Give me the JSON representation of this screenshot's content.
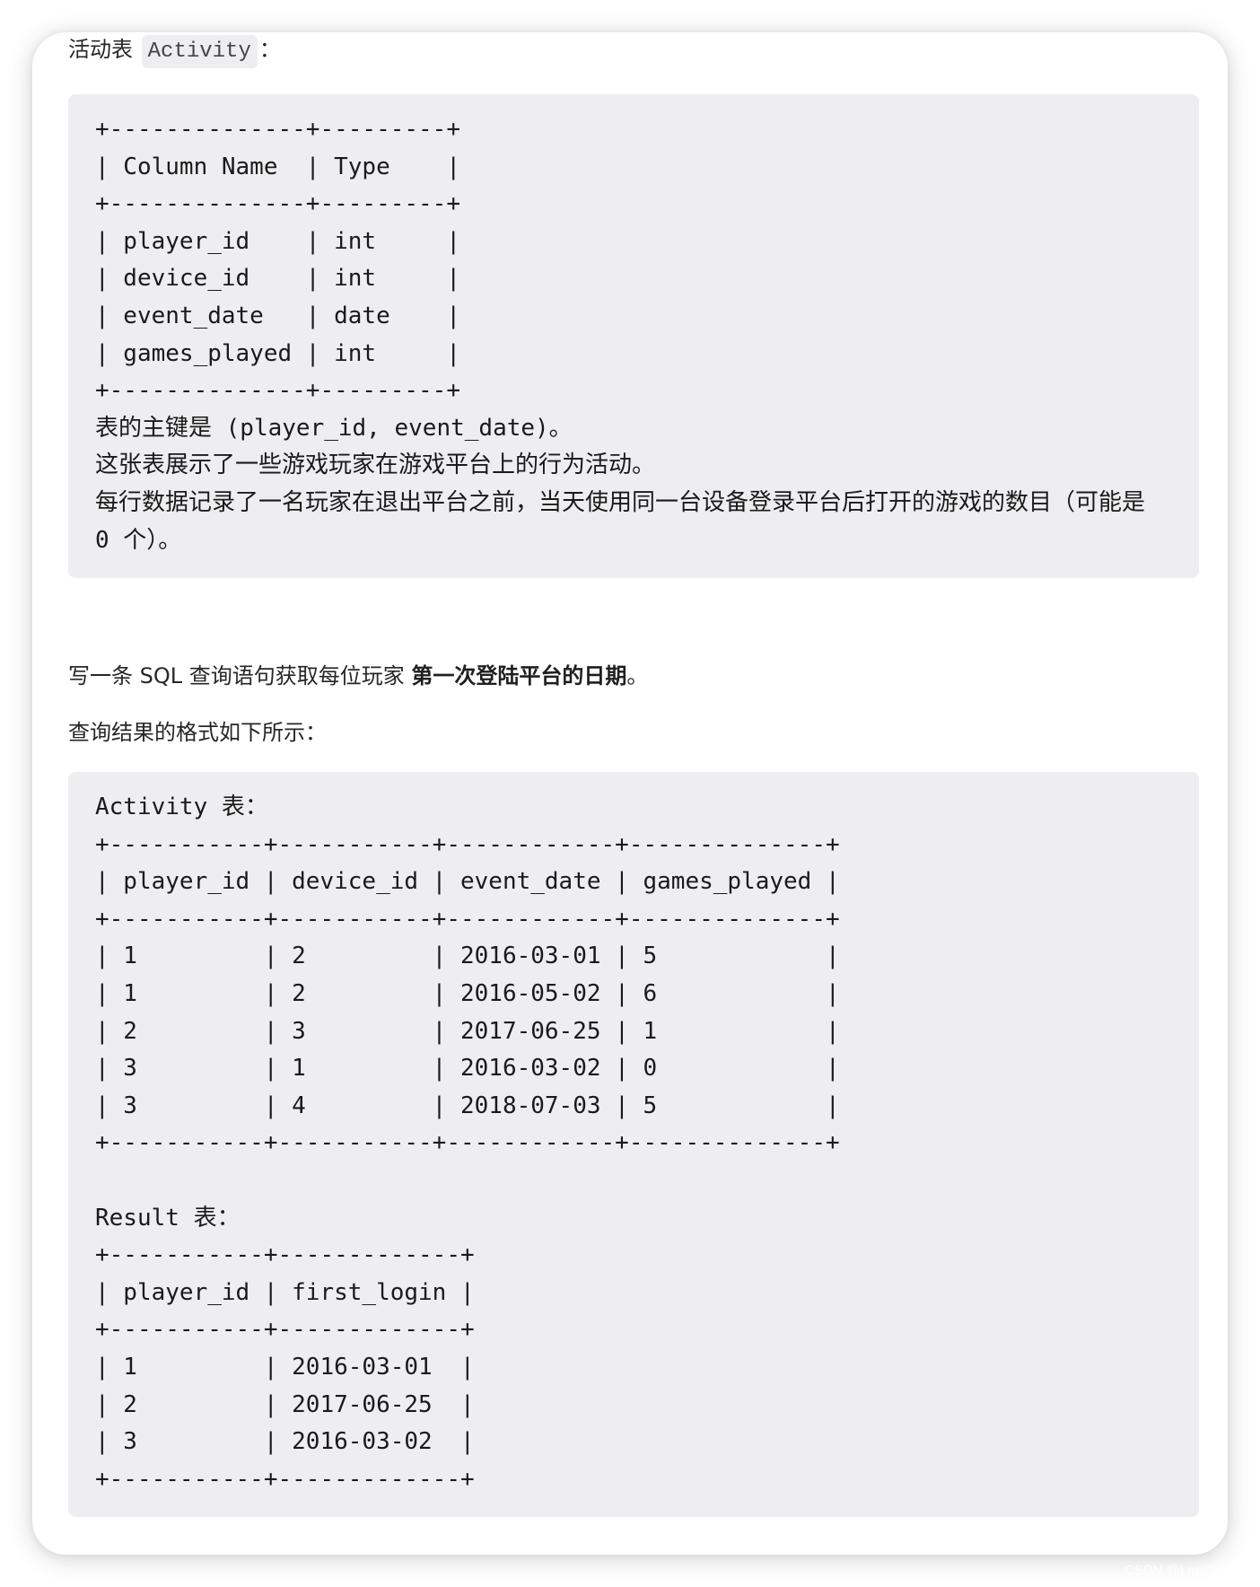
{
  "intro": {
    "prefix": "活动表",
    "table_name": "Activity",
    "suffix": "："
  },
  "schema_block": {
    "lines": [
      "+--------------+---------+",
      "| Column Name  | Type    |",
      "+--------------+---------+",
      "| player_id    | int     |",
      "| device_id    | int     |",
      "| event_date   | date    |",
      "| games_played | int     |",
      "+--------------+---------+",
      "表的主键是 (player_id, event_date)。",
      "这张表展示了一些游戏玩家在游戏平台上的行为活动。",
      "每行数据记录了一名玩家在退出平台之前，当天使用同一台设备登录平台后打开的游戏的数目（可能是",
      "0 个）。"
    ],
    "columns": [
      {
        "name": "player_id",
        "type": "int"
      },
      {
        "name": "device_id",
        "type": "int"
      },
      {
        "name": "event_date",
        "type": "date"
      },
      {
        "name": "games_played",
        "type": "int"
      }
    ],
    "header": [
      "Column Name",
      "Type"
    ]
  },
  "task": {
    "prefix": "写一条 SQL 查询语句获取每位玩家 ",
    "bold": "第一次登陆平台的日期",
    "suffix": "。"
  },
  "format_intro": "查询结果的格式如下所示：",
  "example_block": {
    "lines": [
      "Activity 表：",
      "+-----------+-----------+------------+--------------+",
      "| player_id | device_id | event_date | games_played |",
      "+-----------+-----------+------------+--------------+",
      "| 1         | 2         | 2016-03-01 | 5            |",
      "| 1         | 2         | 2016-05-02 | 6            |",
      "| 2         | 3         | 2017-06-25 | 1            |",
      "| 3         | 1         | 2016-03-02 | 0            |",
      "| 3         | 4         | 2018-07-03 | 5            |",
      "+-----------+-----------+------------+--------------+",
      "",
      "Result 表：",
      "+-----------+-------------+",
      "| player_id | first_login |",
      "+-----------+-------------+",
      "| 1         | 2016-03-01  |",
      "| 2         | 2017-06-25  |",
      "| 3         | 2016-03-02  |",
      "+-----------+-------------+"
    ],
    "activity_table": {
      "header": [
        "player_id",
        "device_id",
        "event_date",
        "games_played"
      ],
      "rows": [
        [
          "1",
          "2",
          "2016-03-01",
          "5"
        ],
        [
          "1",
          "2",
          "2016-05-02",
          "6"
        ],
        [
          "2",
          "3",
          "2017-06-25",
          "1"
        ],
        [
          "3",
          "1",
          "2016-03-02",
          "0"
        ],
        [
          "3",
          "4",
          "2018-07-03",
          "5"
        ]
      ]
    },
    "result_table": {
      "header": [
        "player_id",
        "first_login"
      ],
      "rows": [
        [
          "1",
          "2016-03-01"
        ],
        [
          "2",
          "2017-06-25"
        ],
        [
          "3",
          "2016-03-02"
        ]
      ]
    }
  },
  "watermark": "CSDN @Lmy02080"
}
